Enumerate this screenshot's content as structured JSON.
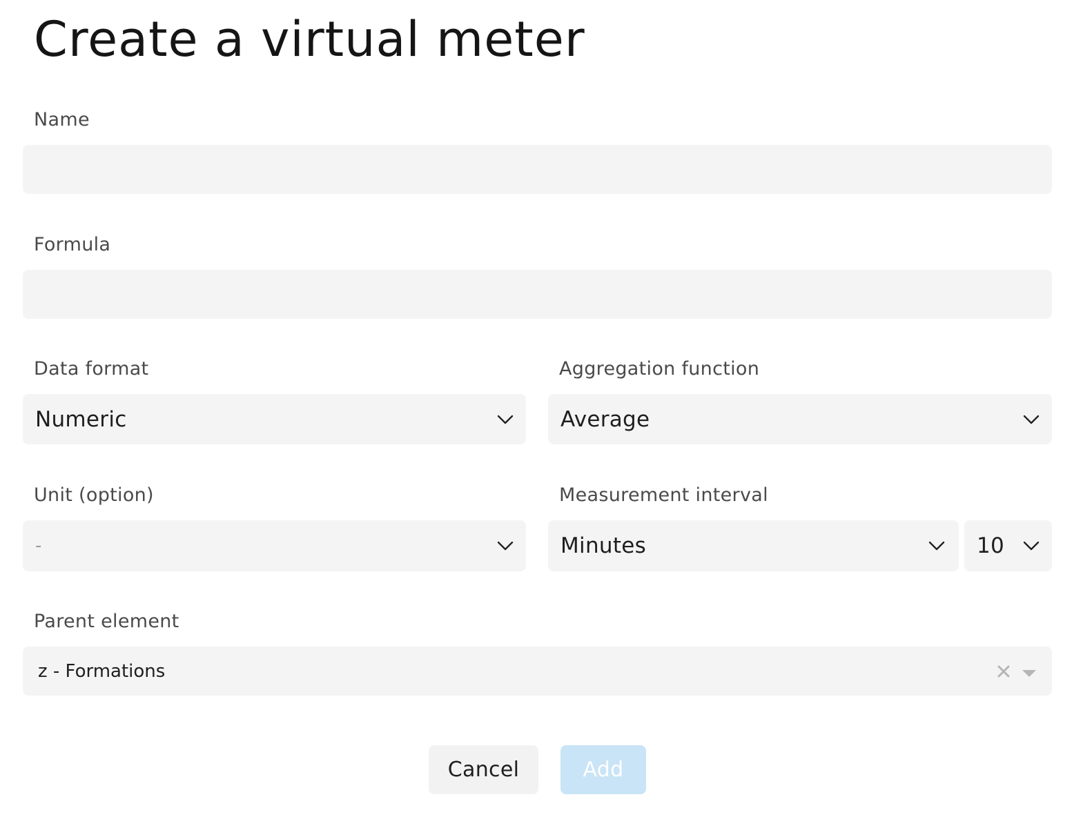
{
  "dialog": {
    "title": "Create a virtual meter"
  },
  "fields": {
    "name": {
      "label": "Name",
      "value": ""
    },
    "formula": {
      "label": "Formula",
      "value": ""
    },
    "data_format": {
      "label": "Data format",
      "value": "Numeric"
    },
    "aggregation_function": {
      "label": "Aggregation function",
      "value": "Average"
    },
    "unit": {
      "label": "Unit (option)",
      "value": "-"
    },
    "measurement_interval": {
      "label": "Measurement interval",
      "unit_value": "Minutes",
      "amount_value": "10"
    },
    "parent_element": {
      "label": "Parent element",
      "value": "z - Formations"
    }
  },
  "actions": {
    "cancel_label": "Cancel",
    "add_label": "Add",
    "add_disabled": true
  },
  "icons": {
    "select_chevron": "chevron-down-icon",
    "clear": "close-icon",
    "caret": "caret-down-icon"
  },
  "colors": {
    "field_background": "#f4f4f4",
    "add_button_disabled": "#c9e4f6",
    "cancel_button": "#f2f2f2"
  }
}
